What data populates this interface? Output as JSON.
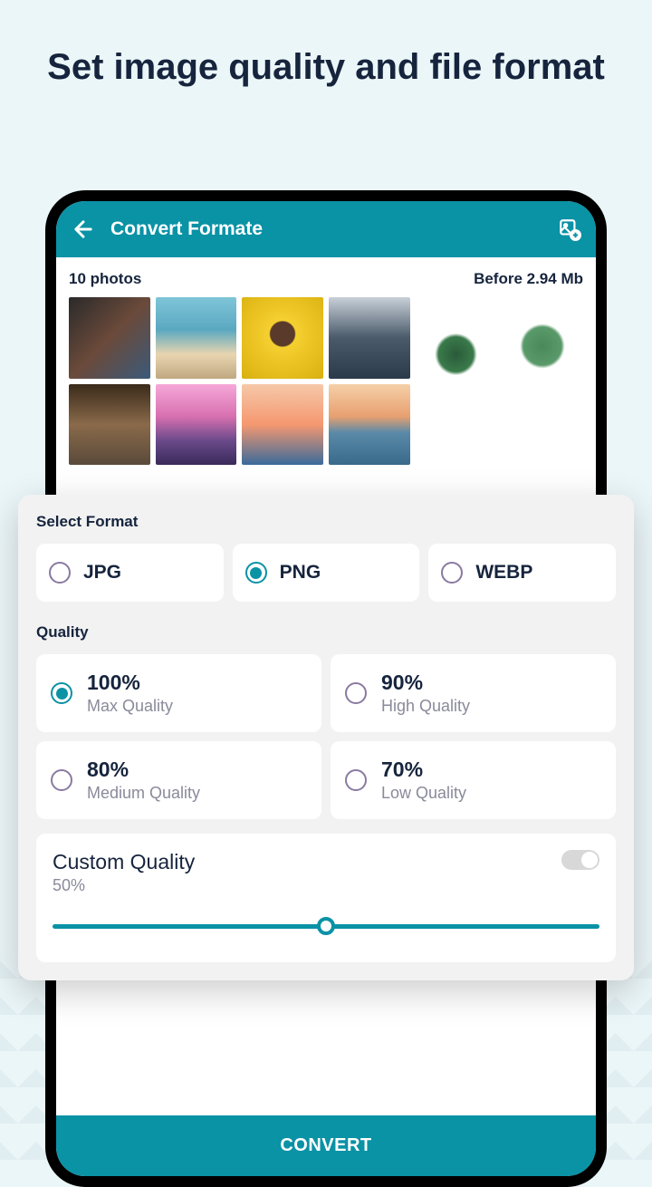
{
  "hero": {
    "title": "Set image quality and file format"
  },
  "appbar": {
    "title": "Convert Formate"
  },
  "status": {
    "count": "10 photos",
    "size": "Before 2.94 Mb"
  },
  "sections": {
    "format": "Select Format",
    "quality": "Quality"
  },
  "formats": [
    {
      "label": "JPG",
      "selected": false
    },
    {
      "label": "PNG",
      "selected": true
    },
    {
      "label": "WEBP",
      "selected": false
    }
  ],
  "qualities": [
    {
      "pct": "100%",
      "desc": "Max Quality",
      "selected": true
    },
    {
      "pct": "90%",
      "desc": "High Quality",
      "selected": false
    },
    {
      "pct": "80%",
      "desc": "Medium Quality",
      "selected": false
    },
    {
      "pct": "70%",
      "desc": "Low Quality",
      "selected": false
    }
  ],
  "custom": {
    "title": "Custom Quality",
    "pct": "50%",
    "enabled": false,
    "value": 50
  },
  "convert": {
    "label": "CONVERT"
  },
  "colors": {
    "primary": "#0a92a5",
    "text": "#16243d"
  }
}
